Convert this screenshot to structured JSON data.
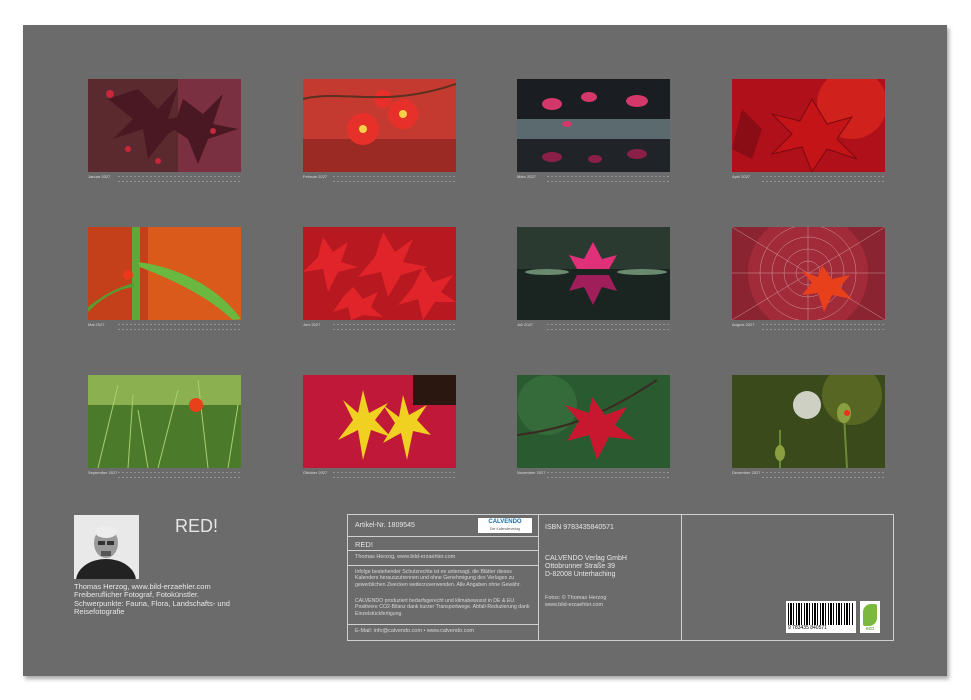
{
  "calendar": {
    "title": "RED!",
    "months": [
      {
        "label": "Januar 2027",
        "photo": "japanese-maple-leaves"
      },
      {
        "label": "Februar 2027",
        "photo": "quince-blossoms"
      },
      {
        "label": "März 2027",
        "photo": "water-lilies-pond"
      },
      {
        "label": "April 2027",
        "photo": "red-maple-leaf-closeup"
      },
      {
        "label": "Mai 2027",
        "photo": "green-stem-on-orange"
      },
      {
        "label": "Juni 2027",
        "photo": "red-maple-foliage"
      },
      {
        "label": "Juli 2027",
        "photo": "pink-water-lily-reflection"
      },
      {
        "label": "August 2027",
        "photo": "leaf-in-spiderweb"
      },
      {
        "label": "September 2027",
        "photo": "poppy-in-grass"
      },
      {
        "label": "Oktober 2027",
        "photo": "yellow-maple-on-red"
      },
      {
        "label": "November 2027",
        "photo": "red-leaf-on-branch"
      },
      {
        "label": "Dezember 2027",
        "photo": "dandelion-poppy-buds"
      }
    ]
  },
  "author": {
    "name_line": "Thomas Herzog, www.bild-erzaehler.com",
    "bio": "Freiberuflicher Fotograf, Fotokünstler. Schwerpunkte: Fauna, Flora, Landschafts- und Reisefotografie"
  },
  "info": {
    "article": "Artikel-Nr. 1809545",
    "brand": "CALVENDO",
    "brand_sub": "Der Kalenderverlag",
    "title": "RED!",
    "author_url": "Thomas Herzog, www.bild-erzaehler.com",
    "legal1": "Infolge bestehender Schutzrechte ist es untersagt, die Blätter dieses Kalenders herauszutrennen und ohne Genehmigung des Verlages zu gewerblichen Zwecken weiterzuverwenden. Alle Angaben ohne Gewähr.",
    "legal2": "CALVENDO produziert bedarfsgerecht und klimabewusst in DE & EU. Positivere CO2-Bilanz dank kurzer Transportwege. Abfall-Reduzierung dank Einzelstückfertigung.",
    "contact": "E-Mail: info@calvendo.com • www.calvendo.com",
    "isbn": "ISBN 9783435840571",
    "publisher_name": "CALVENDO Verlag GmbH",
    "publisher_street": "Ottobrunner Straße 39",
    "publisher_city": "D-82008 Unterhaching",
    "photos_credit": "Fotos: © Thomas Herzog",
    "photos_url": "www.bild-erzaehler.com",
    "barcode_number": "9 783435 840571",
    "eco_label": "eco"
  }
}
